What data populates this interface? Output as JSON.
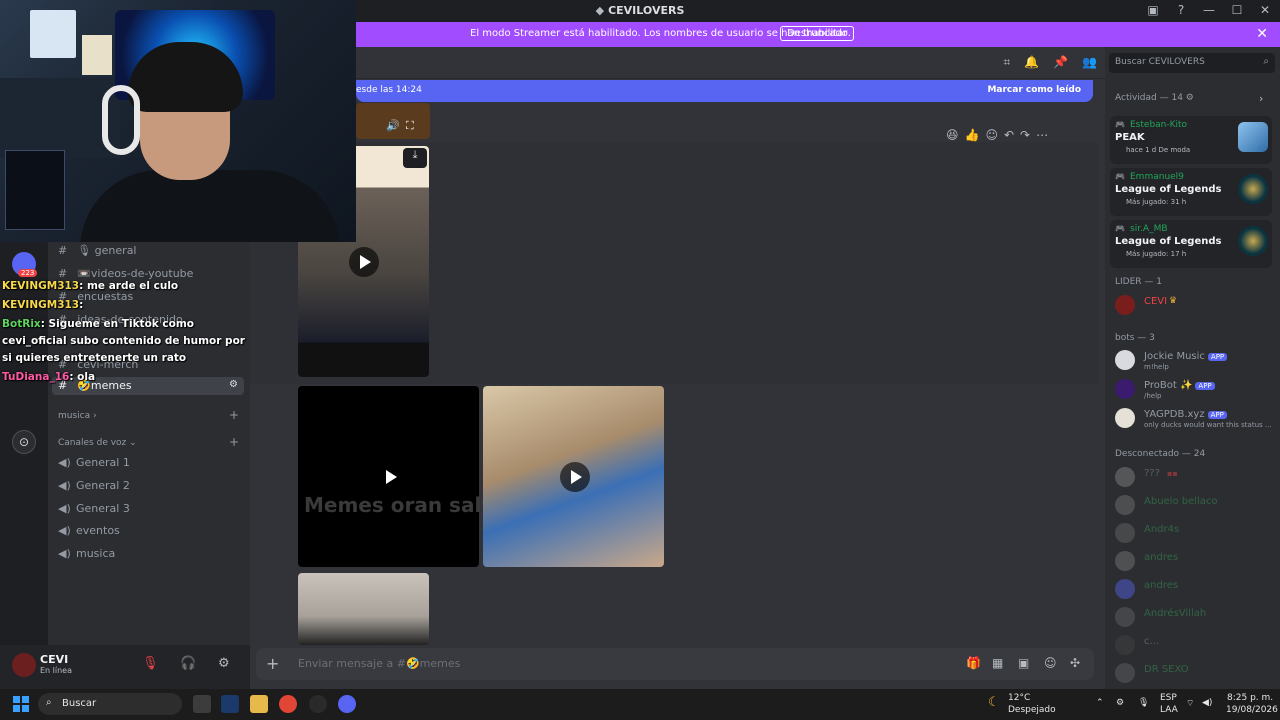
{
  "window": {
    "title": "CEVILOVERS"
  },
  "banner": {
    "text": "El modo Streamer está habilitado. Los nombres de usuario se han truncado.",
    "button": "Deshabilitar"
  },
  "header": {},
  "newbar": {
    "left": "esde las 14:24",
    "right": "Marcar como leído"
  },
  "channels": {
    "items": [
      {
        "label": "🎙 general"
      },
      {
        "label": "📼videos-de-youtube"
      },
      {
        "label": "encuestas"
      },
      {
        "label": "ideas-de-contenido"
      },
      {
        "label": "cevi-merch"
      },
      {
        "label": "🤣memes"
      }
    ],
    "categories": {
      "musica": "musica",
      "voz": "Canales de voz"
    },
    "voice": [
      "General 1",
      "General 2",
      "General 3",
      "eventos",
      "musica"
    ]
  },
  "user": {
    "name": "CEVI",
    "status": "En línea"
  },
  "video": {
    "watermark": "Memes oran salta"
  },
  "composer": {
    "placeholder": "Enviar mensaje a #🤣memes"
  },
  "members": {
    "search_placeholder": "Buscar CEVILOVERS",
    "activity_header": "Actividad — 14",
    "activities": [
      {
        "user": "Esteban-Kito",
        "game": "PEAK",
        "meta": "hace 1 d   De moda",
        "art_color": "#6aa6d8"
      },
      {
        "user": "Emmanuel9",
        "game": "League of Legends",
        "meta": "Más jugado: 31 h",
        "art_color": "#0b3440"
      },
      {
        "user": "sir.A_MB",
        "game": "League of Legends",
        "meta": "Más jugado: 17 h",
        "art_color": "#0b3440"
      }
    ],
    "lider_header": "LIDER — 1",
    "lider": {
      "name": "CEVI",
      "color": "#ed4245"
    },
    "bots_header": "bots — 3",
    "bots": [
      {
        "name": "Jockie Music",
        "sub": "m!help",
        "badge": "APP"
      },
      {
        "name": "ProBot ✨",
        "sub": "/help",
        "badge": "APP"
      },
      {
        "name": "YAGPDB.xyz",
        "sub": "only ducks would want this status ...",
        "badge": "APP"
      }
    ],
    "offline_header": "Desconectado — 24",
    "offline": [
      "???",
      "Abuelo bellaco",
      "Andr4s",
      "andres",
      "andres",
      "AndrésVillah",
      "c...",
      "DR SEXO"
    ]
  },
  "stream_chat": [
    {
      "name": "KEVINGM313",
      "msg": ": me arde el culo",
      "color": "yellow"
    },
    {
      "name": "KEVINGM313",
      "msg": ":",
      "color": "yellow"
    },
    {
      "name": "BotRix",
      "msg": ": Sigueme en Tiktok como",
      "color": "green"
    },
    {
      "name": "",
      "msg": "cevi_oficial subo contenido de humor por",
      "color": ""
    },
    {
      "name": "",
      "msg": "si quieres entretenerte un rato",
      "color": ""
    },
    {
      "name": "TuDiana_16",
      "msg": ": ola",
      "color": "pink"
    }
  ],
  "rail": {
    "badge": "223"
  },
  "taskbar": {
    "search": "Buscar",
    "weather_temp": "12°C",
    "weather_desc": "Despejado",
    "lang": "ESP",
    "lang2": "LAA",
    "time": "8:25 p. m.",
    "date": "19/08/2026"
  }
}
